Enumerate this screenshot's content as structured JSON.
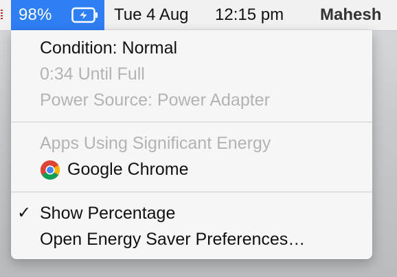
{
  "menubar": {
    "battery_percentage": "98%",
    "battery_icon": "battery-charging-icon",
    "date": "Tue 4 Aug",
    "time": "12:15 pm",
    "user": "Mahesh"
  },
  "battery_menu": {
    "condition": "Condition: Normal",
    "time_until_full": "0:34 Until Full",
    "power_source": "Power Source: Power Adapter",
    "apps_header": "Apps Using Significant Energy",
    "apps": [
      {
        "name": "Google Chrome",
        "icon": "google-chrome-icon"
      }
    ],
    "show_percentage": {
      "label": "Show Percentage",
      "checked": true,
      "check_glyph": "✓"
    },
    "open_preferences": "Open Energy Saver Preferences…"
  },
  "colors": {
    "highlight": "#2f7ff4",
    "menu_background": "#f6f6f6",
    "disabled_text": "#b3b3b3",
    "enabled_text": "#111111"
  }
}
